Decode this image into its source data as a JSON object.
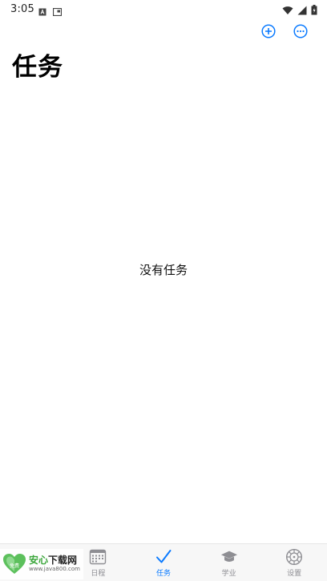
{
  "status_bar": {
    "time": "3:05"
  },
  "header": {
    "title": "任务"
  },
  "main": {
    "empty_message": "没有任务"
  },
  "tabs": [
    {
      "label": "日程",
      "icon": "calendar-icon",
      "active": false
    },
    {
      "label": "任务",
      "icon": "checkmark-icon",
      "active": true
    },
    {
      "label": "学业",
      "icon": "graduation-cap-icon",
      "active": false
    },
    {
      "label": "设置",
      "icon": "settings-gear-icon",
      "active": false
    }
  ],
  "watermark": {
    "brand_a": "安心",
    "brand_b": "下载网",
    "url": "www.java800.com",
    "badge": "免费"
  },
  "colors": {
    "accent": "#0a7aff",
    "inactive": "#8e8e93",
    "tab_bar_bg": "#f7f7f7"
  }
}
